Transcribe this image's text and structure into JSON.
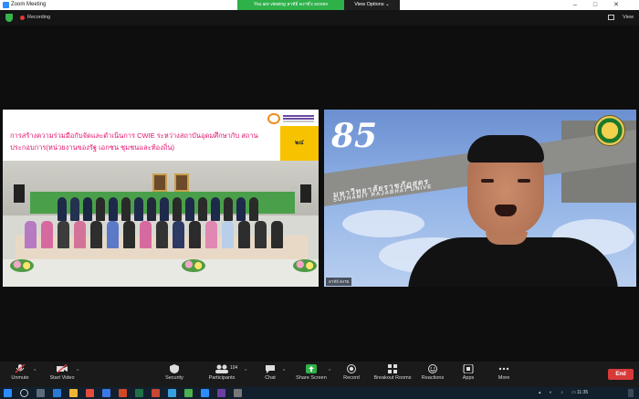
{
  "window": {
    "title": "Zoom Meeting"
  },
  "share_banner": {
    "text": "You are viewing สาทัย์ คงฯย์'s screen",
    "options": "View Options ⌄"
  },
  "topbar": {
    "recording": "Recording",
    "view": "View"
  },
  "left_tile": {
    "slide_title": "การสร้างความร่วมมือกับจัดและดำเนินการ CWIE ระหว่างสถาบันอุดมศึกษากับ สถานประกอบการ(หน่วยงานของรัฐ เอกชน ชุมชนและท้องถิ่น)",
    "page_number": "๒๔"
  },
  "right_tile": {
    "banner_number": "85",
    "gate_text": "มหาวิทยาลัยราชภัฏสุดร",
    "gate_sub": "SUTHAMIT RAJABHAT UNIVE",
    "participant_name": "สาทัย์ คงรย"
  },
  "toolbar": {
    "unmute": "Unmute",
    "start_video": "Start Video",
    "security": "Security",
    "participants": "Participants",
    "participants_count": "104",
    "chat": "Chat",
    "share_screen": "Share Screen",
    "record": "Record",
    "breakout": "Breakout Rooms",
    "reactions": "Reactions",
    "apps": "Apps",
    "more": "More",
    "end": "End"
  },
  "taskbar": {
    "time": "11:35"
  },
  "colors": {
    "accent_green": "#2fb14a",
    "end_red": "#d83a3a",
    "zoom_blue": "#2d8cff"
  }
}
